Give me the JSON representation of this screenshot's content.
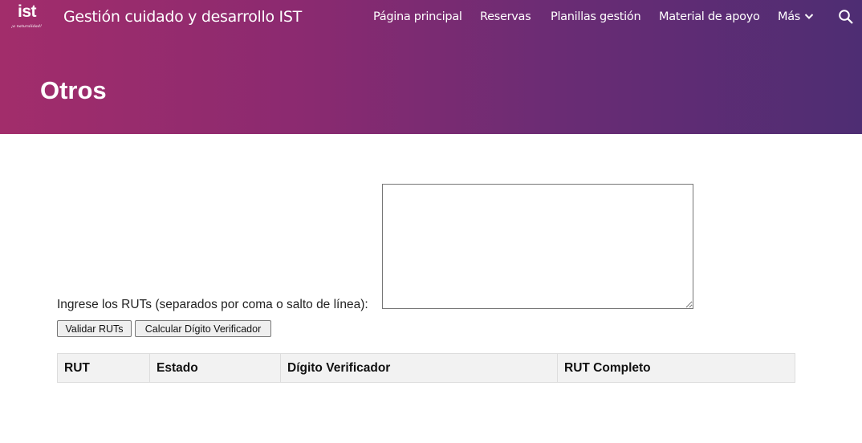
{
  "header": {
    "logo_text": "ist",
    "logo_tagline": "¡a naturalidad!",
    "site_title": "Gestión cuidado y desarrollo IST",
    "nav": [
      {
        "label": "Página principal"
      },
      {
        "label": "Reservas"
      },
      {
        "label": "Planillas gestión"
      },
      {
        "label": "Material de apoyo"
      },
      {
        "label": "Más"
      }
    ],
    "search_icon": "search-icon",
    "more_icon": "chevron-down-icon"
  },
  "page": {
    "title": "Otros"
  },
  "form": {
    "label": "Ingrese los RUTs (separados por coma o salto de línea):",
    "textarea_value": "",
    "validate_button": "Validar RUTs",
    "calc_button": "Calcular Dígito Verificador"
  },
  "table": {
    "headers": [
      "RUT",
      "Estado",
      "Dígito Verificador",
      "RUT Completo"
    ],
    "rows": []
  },
  "colors": {
    "banner_start": "#a22d6b",
    "banner_end": "#4e2d73"
  }
}
